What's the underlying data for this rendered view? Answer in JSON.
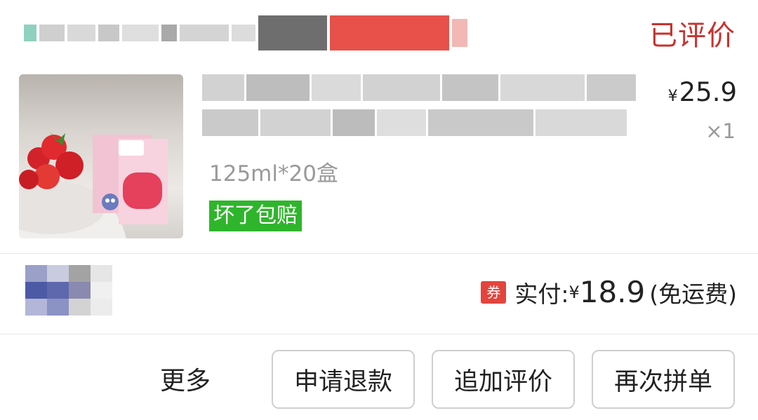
{
  "order": {
    "status": "已评价"
  },
  "product": {
    "spec": "125ml*20盒",
    "tag": "坏了包赔",
    "price_currency": "¥",
    "price": "25.9",
    "quantity": "×1"
  },
  "payment": {
    "coupon_label": "券",
    "label": "实付:",
    "currency": "¥",
    "amount": "18.9",
    "note": "(免运费)"
  },
  "actions": {
    "more": "更多",
    "refund": "申请退款",
    "add_review": "追加评价",
    "rebuy": "再次拼单"
  },
  "colors": {
    "status": "#c8322f",
    "tag_bg": "#2fb52b",
    "coupon_bg": "#e3443c"
  }
}
